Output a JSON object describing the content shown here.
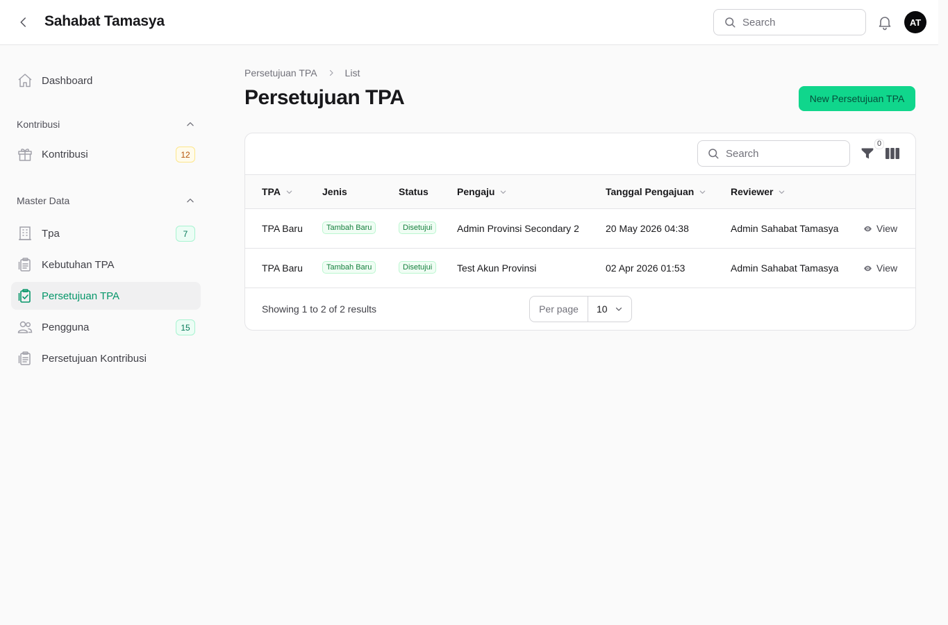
{
  "app": {
    "title": "Sahabat Tamasya",
    "avatar_initials": "AT",
    "search_placeholder": "Search"
  },
  "sidebar": {
    "dashboard": {
      "label": "Dashboard",
      "icon": "home-icon"
    },
    "groups": [
      {
        "label": "Kontribusi",
        "items": [
          {
            "label": "Kontribusi",
            "badge": "12",
            "icon": "gift-icon"
          }
        ]
      },
      {
        "label": "Master Data",
        "items": [
          {
            "label": "Tpa",
            "badge": "7",
            "icon": "building-icon"
          },
          {
            "label": "Kebutuhan TPA",
            "icon": "clipboard-icon"
          },
          {
            "label": "Persetujuan TPA",
            "icon": "clipboard-check-icon",
            "active": true
          },
          {
            "label": "Pengguna",
            "badge": "15",
            "icon": "users-icon"
          },
          {
            "label": "Persetujuan Kontribusi",
            "icon": "clipboard-icon"
          }
        ]
      }
    ]
  },
  "main": {
    "breadcrumb": [
      "Persetujuan TPA",
      "List"
    ],
    "title": "Persetujuan TPA",
    "new_button": "New Persetujuan TPA"
  },
  "table": {
    "search_placeholder": "Search",
    "filter_count": "0",
    "columns": [
      "TPA",
      "Jenis",
      "Status",
      "Pengaju",
      "Tanggal Pengajuan",
      "Reviewer"
    ],
    "rows": [
      {
        "tpa": "TPA Baru",
        "jenis": "Tambah Baru",
        "status": "Disetujui",
        "pengaju": "Admin Provinsi Secondary 2",
        "tanggal": "20 May 2026 04:38",
        "reviewer": "Admin Sahabat Tamasya",
        "action": "View"
      },
      {
        "tpa": "TPA Baru",
        "jenis": "Tambah Baru",
        "status": "Disetujui",
        "pengaju": "Test Akun Provinsi",
        "tanggal": "02 Apr 2026 01:53",
        "reviewer": "Admin Sahabat Tamasya",
        "action": "View"
      }
    ],
    "showing": "Showing 1 to 2 of 2 results",
    "per_page_label": "Per page",
    "per_page_value": "10"
  },
  "colors": {
    "accent": "#10d68c",
    "active_text": "#059669"
  }
}
